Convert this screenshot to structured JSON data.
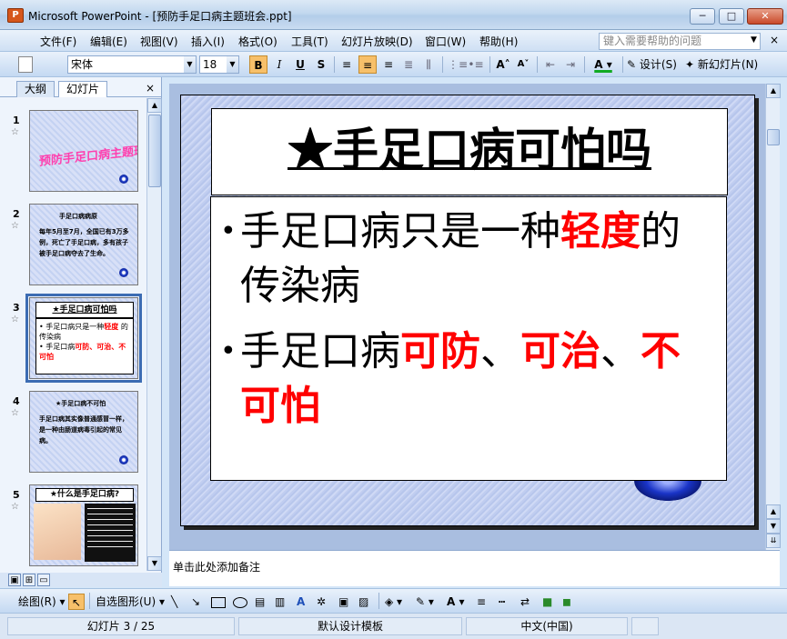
{
  "window": {
    "app_icon": "P",
    "title": "Microsoft PowerPoint - [预防手足口病主题班会.ppt]",
    "min": "─",
    "max": "□",
    "close": "✕"
  },
  "menu": {
    "items": [
      "文件(F)",
      "编辑(E)",
      "视图(V)",
      "插入(I)",
      "格式(O)",
      "工具(T)",
      "幻灯片放映(D)",
      "窗口(W)",
      "帮助(H)"
    ],
    "help_placeholder": "键入需要帮助的问题",
    "doc_close": "×"
  },
  "toolbar": {
    "font": "宋体",
    "size": "18",
    "bold": "B",
    "italic": "I",
    "underline": "U",
    "shadow": "S",
    "design": "设计(S)",
    "new_slide": "新幻灯片(N)"
  },
  "panel": {
    "tab_outline": "大纲",
    "tab_slides": "幻灯片",
    "close": "×"
  },
  "thumbnails": [
    {
      "num": "1",
      "wordart": "预防手足口病主题班会"
    },
    {
      "num": "2",
      "title": "手足口病病原",
      "body": "每年5月至7月，全国已有3万多例，死亡了手足口病，多有孩子被手足口病夺去了生命。"
    },
    {
      "num": "3",
      "title": "★手足口病可怕吗",
      "b1a": "手足口病只是一种",
      "b1b": "轻度",
      "b1c": "的传染病",
      "b2a": "手足口病",
      "b2b": "可防、可治、不可怕"
    },
    {
      "num": "4",
      "title": "★手足口病不可怕",
      "body": "手足口病其实像普通感冒一样，是一种由肠道病毒引起的常见病。"
    },
    {
      "num": "5",
      "title": "★什么是手足口病?"
    }
  ],
  "slide": {
    "title": "★手足口病可怕吗",
    "b1_normal": "手足口病只是一种",
    "b1_red": "轻度",
    "b1_tail": "的传染病",
    "b2_normal": "手足口病",
    "b2_red1": "可防",
    "b2_sep1": "、",
    "b2_red2": "可治",
    "b2_sep2": "、",
    "b2_red3": "不可怕",
    "bullet": "•"
  },
  "notes_placeholder": "单击此处添加备注",
  "drawbar": {
    "draw": "绘图(R)",
    "autoshapes": "自选图形(U)"
  },
  "status": {
    "slide_pos": "幻灯片 3 / 25",
    "template": "默认设计模板",
    "language": "中文(中国)"
  },
  "icons": [
    "app-icon",
    "minimize-icon",
    "maximize-icon",
    "close-icon",
    "new-icon",
    "bold-icon",
    "italic-icon",
    "underline-icon",
    "shadow-icon",
    "align-left-icon",
    "align-center-icon",
    "align-right-icon",
    "font-color-icon",
    "design-icon",
    "new-slide-icon",
    "pointer-icon",
    "line-icon",
    "arrow-icon",
    "rectangle-icon",
    "oval-icon",
    "textbox-icon",
    "fill-color-icon",
    "line-color-icon"
  ],
  "colors": {
    "accent_red": "#ff0000",
    "selection": "#3c6cb3",
    "title_bar": "#c2d8ef"
  }
}
